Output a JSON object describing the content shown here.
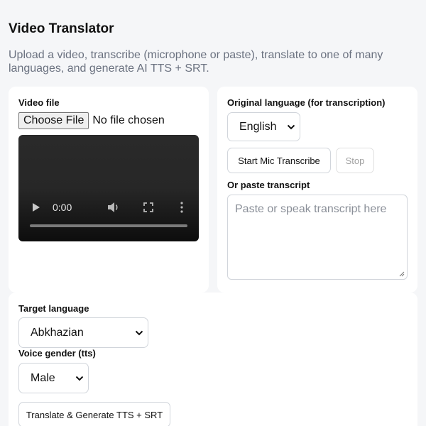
{
  "header": {
    "title": "Video Translator",
    "subtitle": "Upload a video, transcribe (microphone or paste), translate to one of many languages, and generate AI TTS + SRT."
  },
  "video_card": {
    "label": "Video file",
    "file_button": "Choose File",
    "file_status": "No file chosen",
    "player": {
      "time": "0:00",
      "progress": 0
    }
  },
  "original_card": {
    "label": "Original language (for transcription)",
    "language_selected": "English",
    "start_button": "Start Mic Transcribe",
    "stop_button": "Stop",
    "paste_label": "Or paste transcript",
    "textarea_placeholder": "Paste or speak transcript here"
  },
  "target_card": {
    "target_label": "Target language",
    "target_selected": "Abkhazian",
    "voice_label": "Voice gender (tts)",
    "voice_selected": "Male",
    "translate_button": "Translate & Generate TTS + SRT"
  },
  "icons": {
    "play": "play-icon",
    "volume": "volume-icon",
    "fullscreen": "fullscreen-icon",
    "more": "more-vertical-icon",
    "chevron": "chevron-down-icon",
    "resize": "resize-handle-icon"
  },
  "colors": {
    "background": "#f5f6f8",
    "card": "#ffffff",
    "subtitle_text": "#6b7280",
    "border": "#d1d5db"
  }
}
